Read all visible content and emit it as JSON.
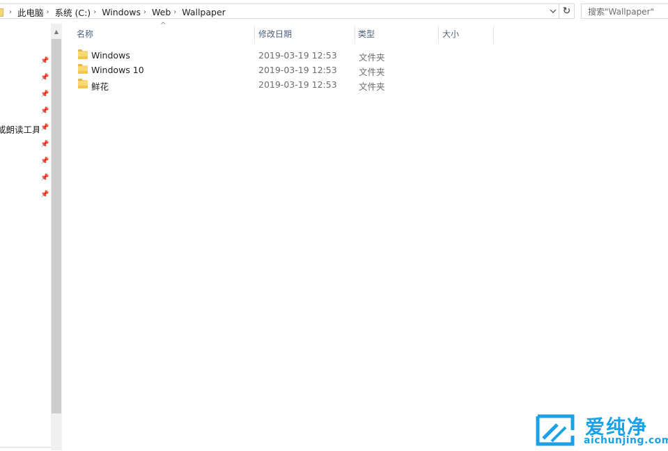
{
  "address_bar": {
    "breadcrumbs": [
      "此电脑",
      "系统 (C:)",
      "Windows",
      "Web",
      "Wallpaper"
    ],
    "separator": "›"
  },
  "search": {
    "placeholder": "搜索\"Wallpaper\""
  },
  "nav_pane": {
    "items": [
      {
        "label": ""
      },
      {
        "label": ""
      },
      {
        "label": ""
      },
      {
        "label": ""
      },
      {
        "label": "或朗读工具\\"
      },
      {
        "label": ""
      },
      {
        "label": ""
      },
      {
        "label": ""
      },
      {
        "label": ""
      }
    ]
  },
  "file_list": {
    "columns": {
      "name": "名称",
      "date": "修改日期",
      "type": "类型",
      "size": "大小"
    },
    "rows": [
      {
        "name": "Windows",
        "date": "2019-03-19 12:53",
        "type": "文件夹"
      },
      {
        "name": "Windows 10",
        "date": "2019-03-19 12:53",
        "type": "文件夹"
      },
      {
        "name": "鲜花",
        "date": "2019-03-19 12:53",
        "type": "文件夹"
      }
    ]
  },
  "watermark": {
    "title": "爱纯净",
    "url": "aichunjing.com",
    "color": "#1aa1e6"
  }
}
